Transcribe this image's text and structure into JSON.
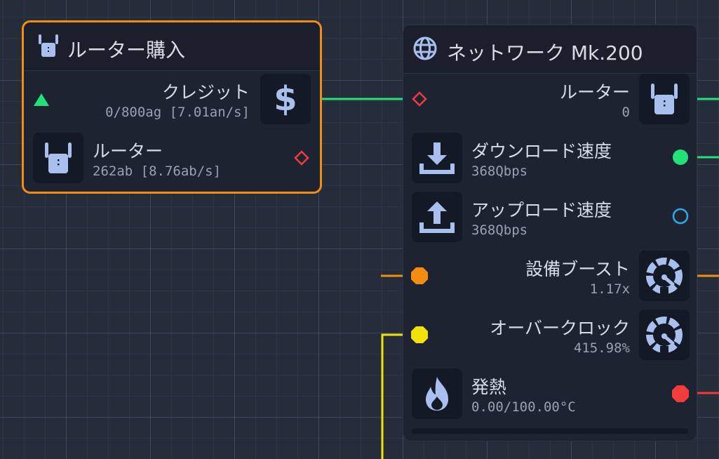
{
  "node_router_purchase": {
    "title": "ルーター購入",
    "title_icon": "router-icon",
    "credit": {
      "label": "クレジット",
      "value": "0/800ag [7.01an/s]",
      "icon": "dollar-icon",
      "port_color": "#22e07a"
    },
    "router": {
      "label": "ルーター",
      "value": "262ab [8.76ab/s]",
      "icon": "router-icon",
      "port_color": "#f03c3c"
    },
    "border_color": "#f28c12"
  },
  "node_network": {
    "title": "ネットワーク Mk.200",
    "title_icon": "globe-icon",
    "router": {
      "label": "ルーター",
      "value": "0",
      "icon": "router-icon",
      "port_color": "#f03c3c"
    },
    "download": {
      "label": "ダウンロード速度",
      "value": "368Qbps",
      "icon": "download-icon",
      "port_color": "#22e07a"
    },
    "upload": {
      "label": "アップロード速度",
      "value": "368Qbps",
      "icon": "upload-icon",
      "port_color": "#2fa9e8"
    },
    "boost": {
      "label": "設備ブースト",
      "value": "1.17x",
      "icon": "gauge-icon",
      "port_color": "#f28c12"
    },
    "overclock": {
      "label": "オーバークロック",
      "value": "415.98%",
      "icon": "gauge-icon",
      "port_color": "#f2e20c"
    },
    "heat": {
      "label": "発熱",
      "value": "0.00/100.00°C",
      "icon": "flame-icon",
      "port_color": "#f03c3c"
    }
  }
}
